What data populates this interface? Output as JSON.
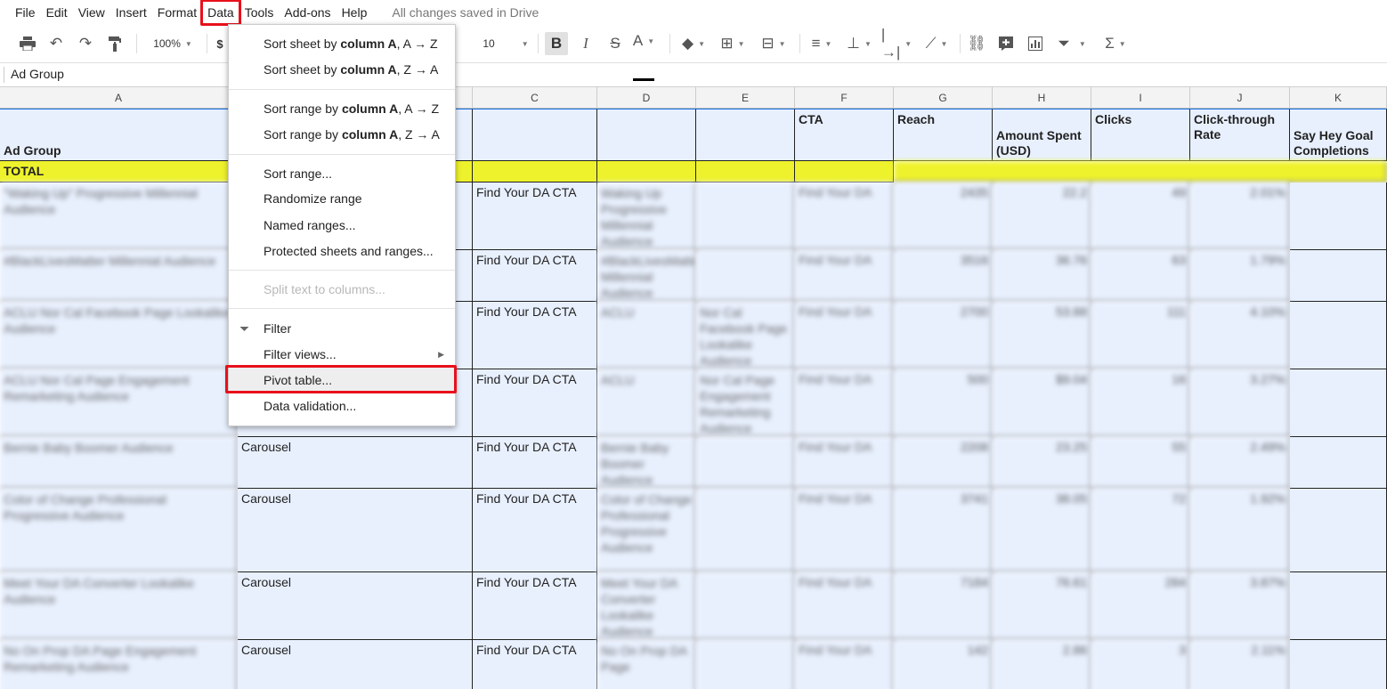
{
  "menu": {
    "items": [
      "File",
      "Edit",
      "View",
      "Insert",
      "Format",
      "Data",
      "Tools",
      "Add-ons",
      "Help"
    ],
    "status": "All changes saved in Drive"
  },
  "toolbar": {
    "zoom": "100%",
    "currency": "$",
    "font_size": "10",
    "bold": "B",
    "italic": "I",
    "strike": "S",
    "text_color": "A",
    "sigma": "Σ"
  },
  "formula_bar": {
    "content": "Ad Group"
  },
  "columns": [
    "A",
    "C",
    "D",
    "E",
    "F",
    "G",
    "H",
    "I",
    "J",
    "K"
  ],
  "headers": {
    "a": "Ad Group",
    "f": "CTA",
    "g": "Reach",
    "h": "Amount Spent (USD)",
    "i": "Clicks",
    "j": "Click-through Rate",
    "k": "Say Hey Goal Completions"
  },
  "total_label": "TOTAL",
  "rows": [
    {
      "a": "\"Waking Up\" Progressive Millennial Audience",
      "b": "",
      "c": "Find Your DA CTA",
      "d": "Waking Up Progressive Millennial Audience",
      "e": "",
      "f": "Find Your DA",
      "g": "2435",
      "h": "22.2",
      "i": "49",
      "j": "2.01%"
    },
    {
      "a": "#BlackLivesMatter Millennial Audience",
      "b": "",
      "c": "Find Your DA CTA",
      "d": "#BlackLivesMatter Millennial Audience",
      "e": "",
      "f": "Find Your DA",
      "g": "3516",
      "h": "36.76",
      "i": "63",
      "j": "1.79%"
    },
    {
      "a": "ACLU Nor Cal Facebook Page Lookalike Audience",
      "b": "",
      "c": "Find Your DA CTA",
      "d": "ACLU",
      "e": "Nor Cal Facebook Page Lookalike Audience",
      "f": "Find Your DA",
      "g": "2700",
      "h": "53.88",
      "i": "111",
      "j": "4.10%"
    },
    {
      "a": "ACLU Nor Cal Page Engagement Remarketing Audience",
      "b": "",
      "c": "Find Your DA CTA",
      "d": "ACLU",
      "e": "Nor Cal Page Engagement Remarketing Audience",
      "f": "Find Your DA",
      "g": "500",
      "h": "$9.04",
      "i": "16",
      "j": "3.27%"
    },
    {
      "a": "Bernie Baby Boomer Audience",
      "b": "Carousel",
      "c": "Find Your DA CTA",
      "d": "Bernie Baby Boomer Audience",
      "e": "",
      "f": "Find Your DA",
      "g": "2208",
      "h": "23.25",
      "i": "55",
      "j": "2.49%"
    },
    {
      "a": "Color of Change Professional Progressive Audience",
      "b": "Carousel",
      "c": "Find Your DA CTA",
      "d": "Color of Change Professional Progressive Audience",
      "e": "",
      "f": "Find Your DA",
      "g": "3741",
      "h": "38.05",
      "i": "72",
      "j": "1.92%"
    },
    {
      "a": "Meet Your DA Converter Lookalike Audience",
      "b": "Carousel",
      "c": "Find Your DA CTA",
      "d": "Meet Your DA Converter Lookalike Audience",
      "e": "",
      "f": "Find Your DA",
      "g": "7184",
      "h": "76.61",
      "i": "284",
      "j": "3.87%"
    },
    {
      "a": "No On Prop DA Page Engagement Remarketing Audience",
      "b": "Carousel",
      "c": "Find Your DA CTA",
      "d": "No On Prop DA Page",
      "e": "",
      "f": "Find Your DA",
      "g": "142",
      "h": "2.86",
      "i": "3",
      "j": "2.11%"
    }
  ],
  "data_menu": {
    "sort_sheet_az_prefix": "Sort sheet by ",
    "sort_sheet_az_bold": "column A",
    "sort_sheet_az_suffix": ", A → Z",
    "sort_sheet_za_prefix": "Sort sheet by ",
    "sort_sheet_za_bold": "column A",
    "sort_sheet_za_suffix": ", Z → A",
    "sort_range_az_prefix": "Sort range by ",
    "sort_range_az_bold": "column A",
    "sort_range_az_suffix": ", A → Z",
    "sort_range_za_prefix": "Sort range by ",
    "sort_range_za_bold": "column A",
    "sort_range_za_suffix": ", Z → A",
    "sort_range": "Sort range...",
    "randomize": "Randomize range",
    "named_ranges": "Named ranges...",
    "protected": "Protected sheets and ranges...",
    "split_text": "Split text to columns...",
    "filter": "Filter",
    "filter_views": "Filter views...",
    "pivot": "Pivot table...",
    "validation": "Data validation..."
  }
}
